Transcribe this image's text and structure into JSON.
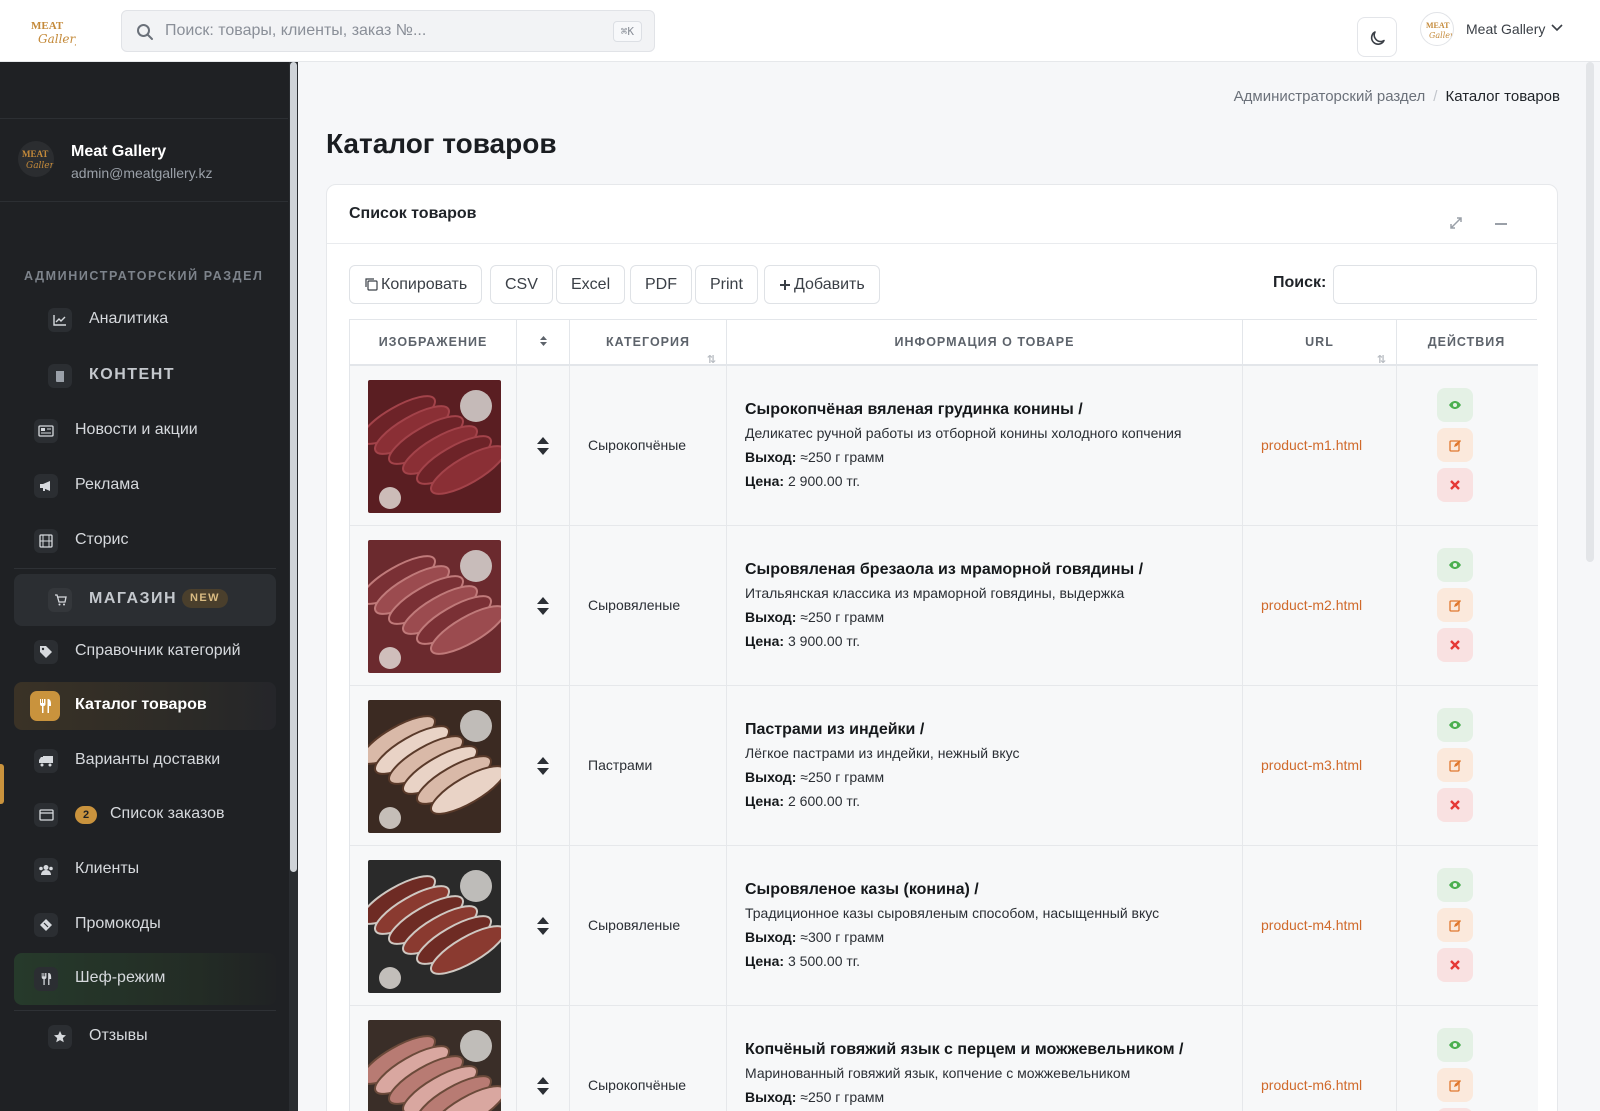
{
  "topbar": {
    "search_placeholder": "Поиск: товары, клиенты, заказ №...",
    "shortcut": "⌘K",
    "user_name": "Meat Gallery"
  },
  "sidebar": {
    "profile": {
      "name": "Meat Gallery",
      "email": "admin@meatgallery.kz"
    },
    "section_label": "АДМИНИСТРАТОРСКИЙ РАЗДЕЛ",
    "items": [
      {
        "label": "Аналитика",
        "icon": "chart-line-icon"
      },
      {
        "label": "КОНТЕНТ",
        "icon": "book-icon"
      },
      {
        "label": "Новости и акции",
        "icon": "newspaper-icon"
      },
      {
        "label": "Реклама",
        "icon": "megaphone-icon"
      },
      {
        "label": "Сторис",
        "icon": "film-icon"
      },
      {
        "label": "МАГАЗИН",
        "icon": "cart-icon",
        "badge": "NEW"
      },
      {
        "label": "Справочник категорий",
        "icon": "tags-icon"
      },
      {
        "label": "Каталог товаров",
        "icon": "utensils-icon"
      },
      {
        "label": "Варианты доставки",
        "icon": "truck-icon"
      },
      {
        "label": "Список заказов",
        "icon": "list-icon",
        "badge": "2"
      },
      {
        "label": "Клиенты",
        "icon": "users-icon"
      },
      {
        "label": "Промокоды",
        "icon": "ticket-icon"
      },
      {
        "label": "Шеф-режим",
        "icon": "utensils-icon"
      },
      {
        "label": "Отзывы",
        "icon": "star-icon"
      }
    ]
  },
  "breadcrumb": {
    "parent": "Администраторский раздел",
    "current": "Каталог товаров"
  },
  "page_title": "Каталог товаров",
  "card": {
    "title": "Список товаров",
    "buttons": {
      "copy": "Копировать",
      "csv": "CSV",
      "excel": "Excel",
      "pdf": "PDF",
      "print": "Print",
      "add": "Добавить"
    },
    "search_label": "Поиск:"
  },
  "table": {
    "headers": [
      "ИЗОБРАЖЕНИЕ",
      "",
      "КАТЕГОРИЯ",
      "ИНФОРМАЦИЯ О ТОВАРЕ",
      "URL",
      "ДЕЙСТВИЯ"
    ],
    "yield_label": "Выход:",
    "price_label": "Цена:",
    "rows": [
      {
        "category": "Сырокопчёные",
        "name": "Сырокопчёная вяленая грудинка конины /",
        "desc": "Деликатес ручной работы из отборной конины холодного копчения",
        "yield": " ≈250 г грамм",
        "price": " 2 900.00 тг.",
        "url": "product-m1.html"
      },
      {
        "category": "Сыровяленые",
        "name": "Сыровяленая брезаола из мраморной говядины /",
        "desc": "Итальянская классика из мраморной говядины, выдержка",
        "yield": " ≈250 г грамм",
        "price": " 3 900.00 тг.",
        "url": "product-m2.html"
      },
      {
        "category": "Пастрами",
        "name": "Пастрами из индейки /",
        "desc": "Лёгкое пастрами из индейки, нежный вкус",
        "yield": " ≈250 г грамм",
        "price": " 2 600.00 тг.",
        "url": "product-m3.html"
      },
      {
        "category": "Сыровяленые",
        "name": "Сыровяленое казы (конина) /",
        "desc": "Традиционное казы сыровяленым способом, насыщенный вкус",
        "yield": " ≈300 г грамм",
        "price": " 3 500.00 тг.",
        "url": "product-m4.html"
      },
      {
        "category": "Сырокопчёные",
        "name": "Копчёный говяжий язык с перцем и можжевельником /",
        "desc": "Маринованный говяжий язык, копчение с можжевельником",
        "yield": " ≈250 г грамм",
        "price": "",
        "url": "product-m6.html"
      }
    ]
  },
  "colors": {
    "accent": "#c9933d",
    "url": "#d06a2c",
    "sidebar_bg": "#1f2124"
  }
}
